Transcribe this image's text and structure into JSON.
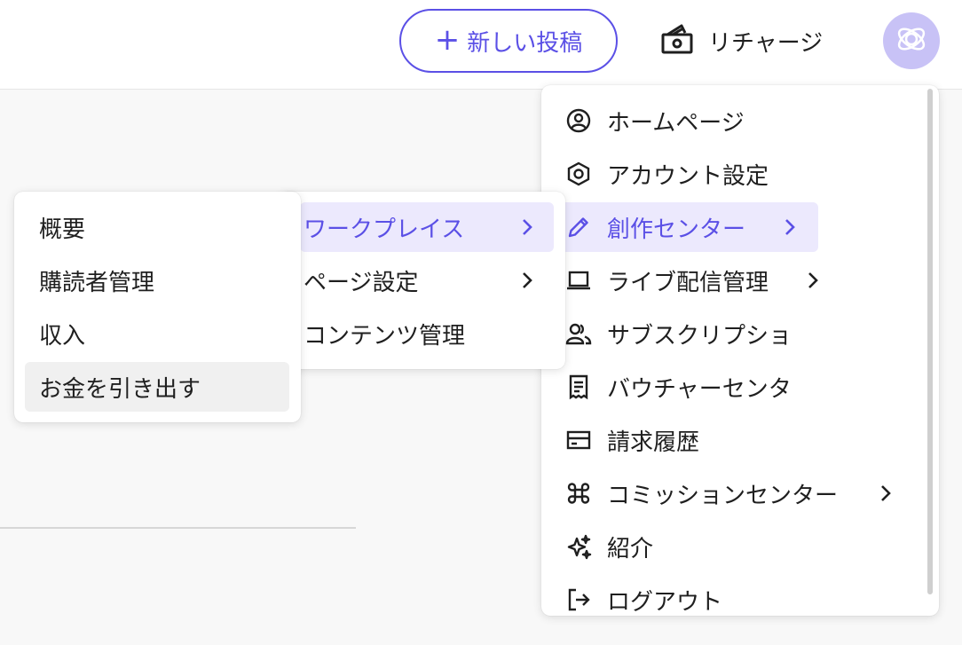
{
  "topbar": {
    "new_post_label": "新しい投稿",
    "recharge_label": "リチャージ"
  },
  "account_menu": {
    "items": [
      {
        "label": "ホームページ",
        "icon": "user-circle-icon"
      },
      {
        "label": "アカウント設定",
        "icon": "hexagon-icon"
      },
      {
        "label": "創作センター",
        "icon": "pencil-icon",
        "has_submenu": true,
        "active": true
      },
      {
        "label": "ライブ配信管理",
        "icon": "laptop-icon",
        "has_submenu": true
      },
      {
        "label": "サブスクリプショ",
        "icon": "users-icon"
      },
      {
        "label": "バウチャーセンタ",
        "icon": "receipt-icon"
      },
      {
        "label": "請求履歴",
        "icon": "credit-card-icon"
      },
      {
        "label": "コミッションセンター",
        "icon": "command-icon",
        "has_submenu": true
      },
      {
        "label": "紹介",
        "icon": "sparkles-icon"
      },
      {
        "label": "ログアウト",
        "icon": "logout-icon"
      }
    ]
  },
  "creator_submenu": {
    "items": [
      {
        "label": "ワークプレイス",
        "has_submenu": true,
        "active": true
      },
      {
        "label": "ページ設定",
        "has_submenu": true
      },
      {
        "label": "コンテンツ管理"
      }
    ]
  },
  "workplace_submenu": {
    "items": [
      {
        "label": "概要"
      },
      {
        "label": "購読者管理"
      },
      {
        "label": "収入"
      },
      {
        "label": "お金を引き出す",
        "hovered": true
      }
    ]
  },
  "colors": {
    "accent": "#5b50e6",
    "accent_bg": "#ece9fd",
    "avatar_bg": "#c8c2f6",
    "hover_bg": "#f0f0f0"
  }
}
